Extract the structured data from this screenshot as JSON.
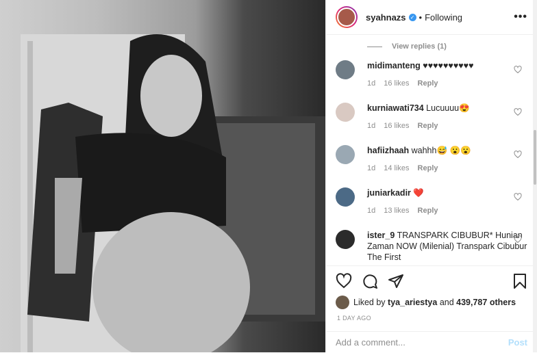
{
  "post": {
    "username": "syahnazs",
    "follow_status": "Following",
    "verified_symbol": "✓",
    "more_symbol": "•••"
  },
  "comments": {
    "view_replies": "View replies (1)",
    "items": [
      {
        "user": "midimanteng",
        "text": "♥♥♥♥♥♥♥♥♥♥",
        "age": "1d",
        "likes": "16 likes",
        "reply": "Reply",
        "avatar_color": "#6f7c86"
      },
      {
        "user": "kurniawati734",
        "text": "Lucuuuu😍",
        "age": "1d",
        "likes": "16 likes",
        "reply": "Reply",
        "avatar_color": "#d9c9c2"
      },
      {
        "user": "hafiizhaah",
        "text": "wahhh😅 😮😮",
        "age": "1d",
        "likes": "14 likes",
        "reply": "Reply",
        "avatar_color": "#9aa8b3"
      },
      {
        "user": "juniarkadir",
        "text": "❤️",
        "age": "1d",
        "likes": "13 likes",
        "reply": "Reply",
        "avatar_color": "#4c6a86"
      },
      {
        "user": "ister_9",
        "text": "TRANSPARK CIBUBUR* Hunian Zaman NOW (Milenial) Transpark Cibubur The First",
        "age": "",
        "likes": "",
        "reply": "",
        "avatar_color": "#2b2b2b"
      }
    ]
  },
  "likes": {
    "prefix": "Liked by",
    "user": "tya_ariestya",
    "middle": "and",
    "others": "439,787 others"
  },
  "timestamp": "1 DAY AGO",
  "add_comment": {
    "placeholder": "Add a comment...",
    "post_label": "Post"
  }
}
